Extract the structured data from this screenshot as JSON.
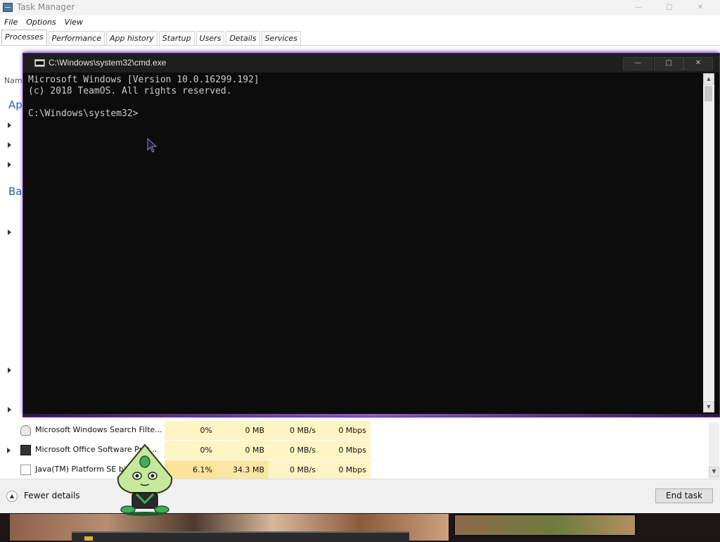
{
  "task_manager": {
    "title": "Task Manager",
    "menu": [
      "File",
      "Options",
      "View"
    ],
    "tabs": [
      "Processes",
      "Performance",
      "App history",
      "Startup",
      "Users",
      "Details",
      "Services"
    ],
    "active_tab": "Processes",
    "name_header": "Name",
    "section_apps": "Ap",
    "section_background": "Bac",
    "processes": [
      {
        "name": "Microsoft Windows Search Filte...",
        "cpu": "0%",
        "memory": "0 MB",
        "disk": "0 MB/s",
        "network": "0 Mbps",
        "icon": "user-icon"
      },
      {
        "name": "Microsoft Office Software Prot...",
        "cpu": "0%",
        "memory": "0 MB",
        "disk": "0 MB/s",
        "network": "0 Mbps",
        "icon": "office-icon"
      },
      {
        "name": "Java(TM) Platform SE binary",
        "cpu": "6.1%",
        "memory": "34.3 MB",
        "disk": "0 MB/s",
        "network": "0 Mbps",
        "icon": "java-icon"
      }
    ],
    "fewer_details": "Fewer details",
    "end_task": "End task"
  },
  "cmd": {
    "title": "C:\\Windows\\system32\\cmd.exe",
    "lines": [
      "Microsoft Windows [Version 10.0.16299.192]",
      "(c) 2018 TeamOS. All rights reserved.",
      "",
      "C:\\Windows\\system32>"
    ]
  },
  "colors": {
    "accent_purple": "#8d5cc8",
    "heat_yellow": "#fff4c4",
    "section_blue": "#2a5fa5"
  }
}
